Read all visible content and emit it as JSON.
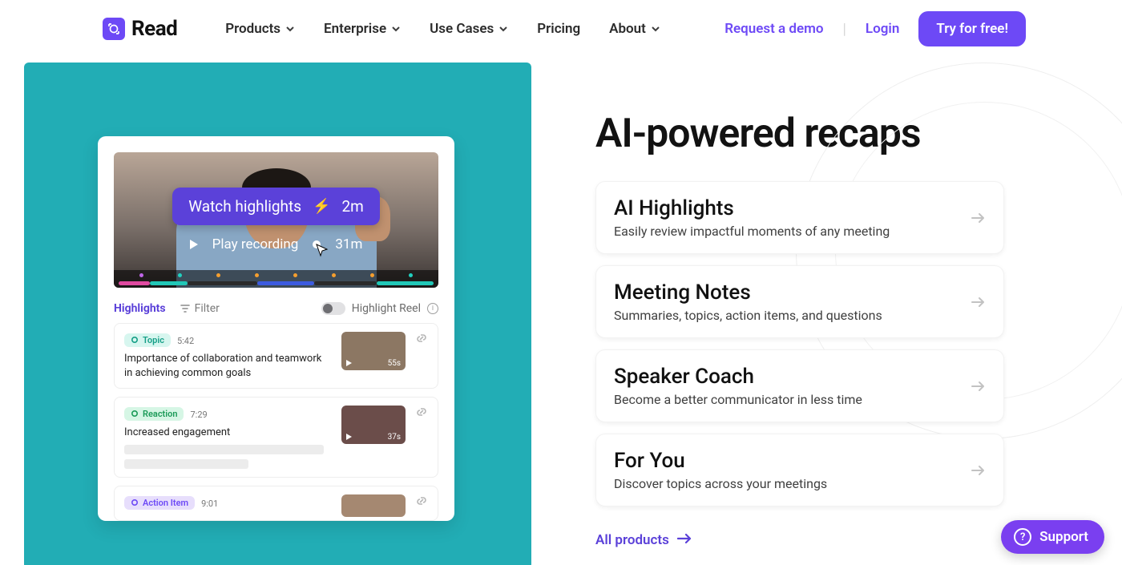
{
  "brand": "Read",
  "nav": {
    "products": "Products",
    "enterprise": "Enterprise",
    "useCases": "Use Cases",
    "pricing": "Pricing",
    "about": "About"
  },
  "header": {
    "requestDemo": "Request a demo",
    "login": "Login",
    "cta": "Try for free!"
  },
  "mock": {
    "watchHighlights": "Watch highlights",
    "highlightsDuration": "2m",
    "playRecording": "Play recording",
    "recordingDuration": "31m",
    "tabHighlights": "Highlights",
    "filter": "Filter",
    "highlightReel": "Highlight Reel",
    "items": [
      {
        "tag": "Topic",
        "tagClass": "tag-topic",
        "time": "5:42",
        "desc": "Importance of collaboration and teamwork in achieving common goals",
        "thumbDur": "55s",
        "kind": "topic"
      },
      {
        "tag": "Reaction",
        "tagClass": "tag-reaction",
        "time": "7:29",
        "desc": "Increased engagement",
        "thumbDur": "37s",
        "kind": "reaction"
      },
      {
        "tag": "Action Item",
        "tagClass": "tag-action",
        "time": "9:01",
        "desc": "",
        "thumbDur": "",
        "kind": "action"
      }
    ]
  },
  "right": {
    "heading": "AI-powered recaps",
    "cards": [
      {
        "title": "AI Highlights",
        "sub": "Easily review impactful moments of any meeting"
      },
      {
        "title": "Meeting Notes",
        "sub": "Summaries, topics, action items, and questions"
      },
      {
        "title": "Speaker Coach",
        "sub": "Become a better communicator in less time"
      },
      {
        "title": "For You",
        "sub": "Discover topics across your meetings"
      }
    ],
    "allProducts": "All products"
  },
  "support": "Support"
}
